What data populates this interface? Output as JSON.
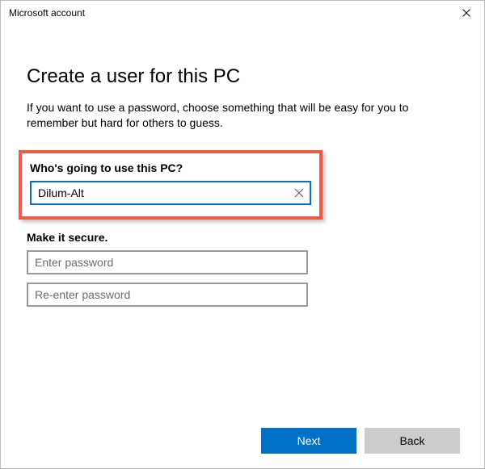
{
  "window": {
    "title": "Microsoft account"
  },
  "header": {
    "title": "Create a user for this PC",
    "subtitle": "If you want to use a password, choose something that will be easy for you to remember but hard for others to guess."
  },
  "username_section": {
    "label": "Who's going to use this PC?",
    "value": "Dilum-Alt"
  },
  "password_section": {
    "label": "Make it secure.",
    "password_placeholder": "Enter password",
    "password_value": "",
    "reenter_placeholder": "Re-enter password",
    "reenter_value": ""
  },
  "footer": {
    "next_label": "Next",
    "back_label": "Back"
  }
}
